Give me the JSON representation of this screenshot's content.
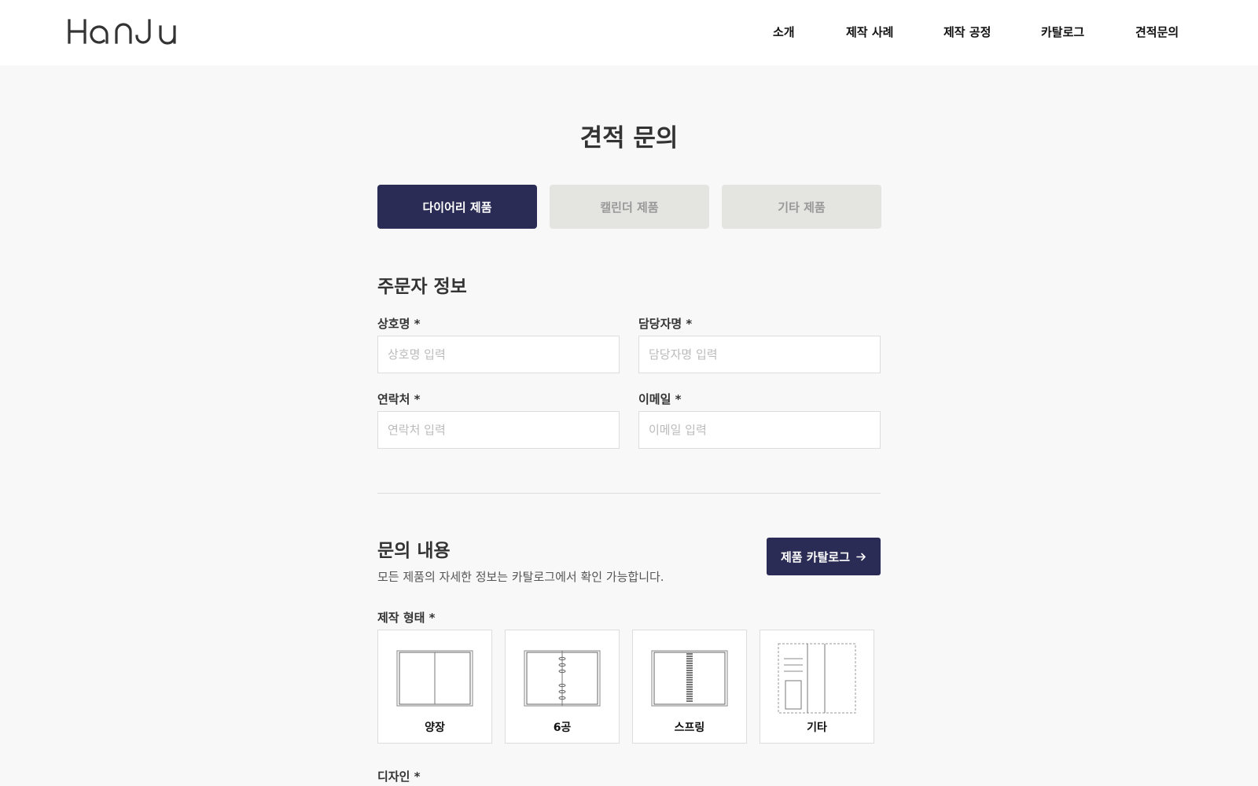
{
  "header": {
    "logo": "Hanju",
    "nav": [
      "소개",
      "제작 사례",
      "제작 공정",
      "카탈로그",
      "견적문의"
    ]
  },
  "page": {
    "title": "견적 문의"
  },
  "tabs": [
    "다이어리 제품",
    "캘린더 제품",
    "기타 제품"
  ],
  "orderer": {
    "title": "주문자 정보",
    "fields": [
      {
        "label": "상호명 *",
        "placeholder": "상호명 입력"
      },
      {
        "label": "담당자명 *",
        "placeholder": "담당자명 입력"
      },
      {
        "label": "연락처 *",
        "placeholder": "연락처 입력"
      },
      {
        "label": "이메일 *",
        "placeholder": "이메일 입력"
      }
    ]
  },
  "inquiry": {
    "title": "문의 내용",
    "subtitle": "모든 제품의 자세한 정보는 카탈로그에서 확인 가능합니다.",
    "catalog_button": "제품 카탈로그",
    "production_type_label": "제작 형태 *",
    "options": [
      {
        "label": "양장",
        "icon": "hardcover-book-icon"
      },
      {
        "label": "6공",
        "icon": "six-ring-binder-icon"
      },
      {
        "label": "스프링",
        "icon": "spiral-binding-icon"
      },
      {
        "label": "기타",
        "icon": "other-binding-icon"
      }
    ],
    "design_label": "디자인 *"
  },
  "colors": {
    "accent": "#2b2c55",
    "inactive_tab": "#e4e4e0",
    "background": "#f8f8f8"
  }
}
